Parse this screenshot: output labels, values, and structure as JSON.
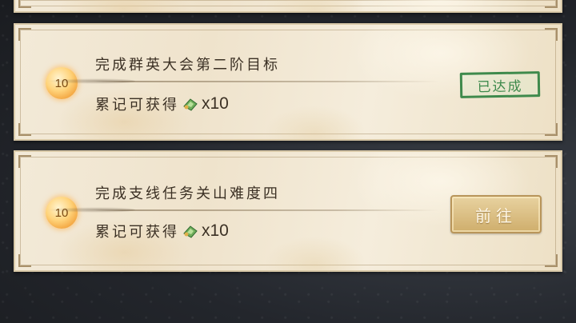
{
  "tasks": [
    {
      "points": "10",
      "title": "完成群英大会第二阶目标",
      "reward_label": "累记可获得",
      "reward_icon": "jade-gem-icon",
      "reward_count": "x10",
      "status": "已达成"
    },
    {
      "points": "10",
      "title": "完成支线任务关山难度四",
      "reward_label": "累记可获得",
      "reward_icon": "jade-gem-icon",
      "reward_count": "x10",
      "action": "前往"
    }
  ],
  "colors": {
    "card_bg": "#f3ead8",
    "stamp_green": "#3e8a4c",
    "button_gold": "#cfae6c",
    "medal_orange": "#f2a23c"
  }
}
